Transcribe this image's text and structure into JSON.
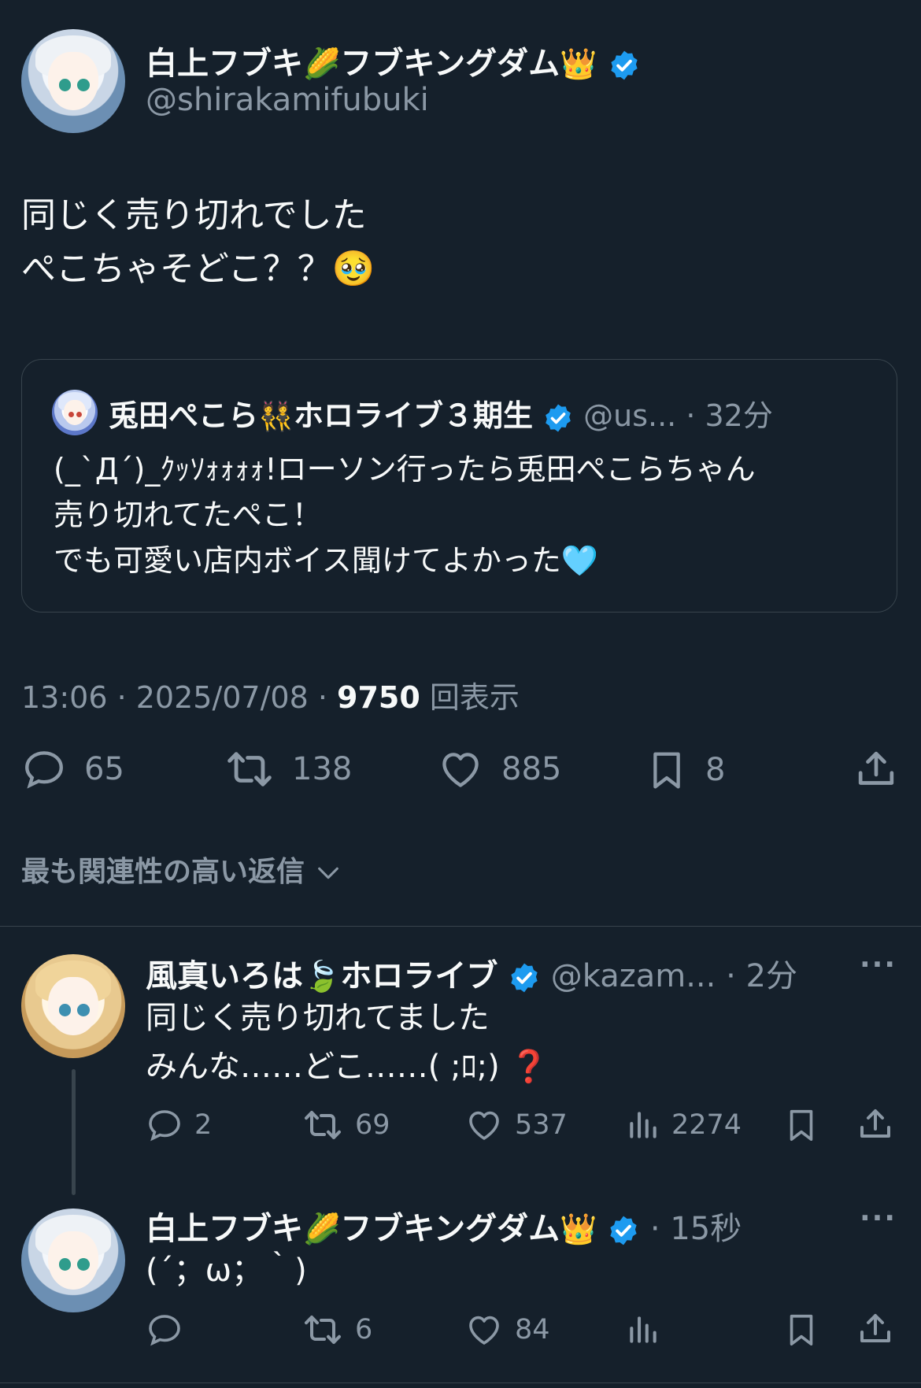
{
  "main_tweet": {
    "author_name": "白上フブキ",
    "author_name_2": "フブキングダム",
    "emoji_1": "🌽",
    "emoji_2": "👑",
    "handle": "@shirakamifubuki",
    "text": "同じく売り切れでした\nぺこちゃそどこ？？🥹",
    "timestamp": "13:06 · 2025/07/08 · ",
    "views_count": "9750",
    "views_label": " 回表示",
    "stats": {
      "replies": "65",
      "retweets": "138",
      "likes": "885",
      "bookmarks": "8"
    }
  },
  "quote_tweet": {
    "author_name": "兎田ぺこら",
    "emoji": "👯",
    "author_name_2": "ホロライブ３期生",
    "handle": "@us...",
    "time": " · 32分",
    "text": "(_`Д´)_ｸｯｿｫｫｫｫ!ローソン行ったら兎田ぺこらちゃん\n売り切れてたぺこ！\nでも可愛い店内ボイス聞けてよかった🩵"
  },
  "replies_header": "最も関連性の高い返信",
  "replies": [
    {
      "author_name": "風真いろは",
      "emoji": "🍃",
      "author_name_2": "ホロライブ",
      "handle": "@kazam...",
      "time": " · 2分",
      "text": "同じく売り切れてました\nみんな……どこ……( ;ﾛ;) ❓",
      "stats": {
        "replies": "2",
        "retweets": "69",
        "likes": "537",
        "views": "2274"
      }
    },
    {
      "author_name": "白上フブキ",
      "emoji_1": "🌽",
      "author_name_2": "フブキングダム",
      "emoji_2": "👑",
      "time": " · 15秒",
      "text": "(´；ω；｀)",
      "stats": {
        "replies": "",
        "retweets": "6",
        "likes": "84",
        "views": ""
      }
    }
  ],
  "more_label": "···",
  "colors": {
    "background": "#15202b",
    "text": "#f7f9f9",
    "muted": "#8b98a5",
    "verified": "#1d9bf0",
    "border": "#38444d"
  }
}
